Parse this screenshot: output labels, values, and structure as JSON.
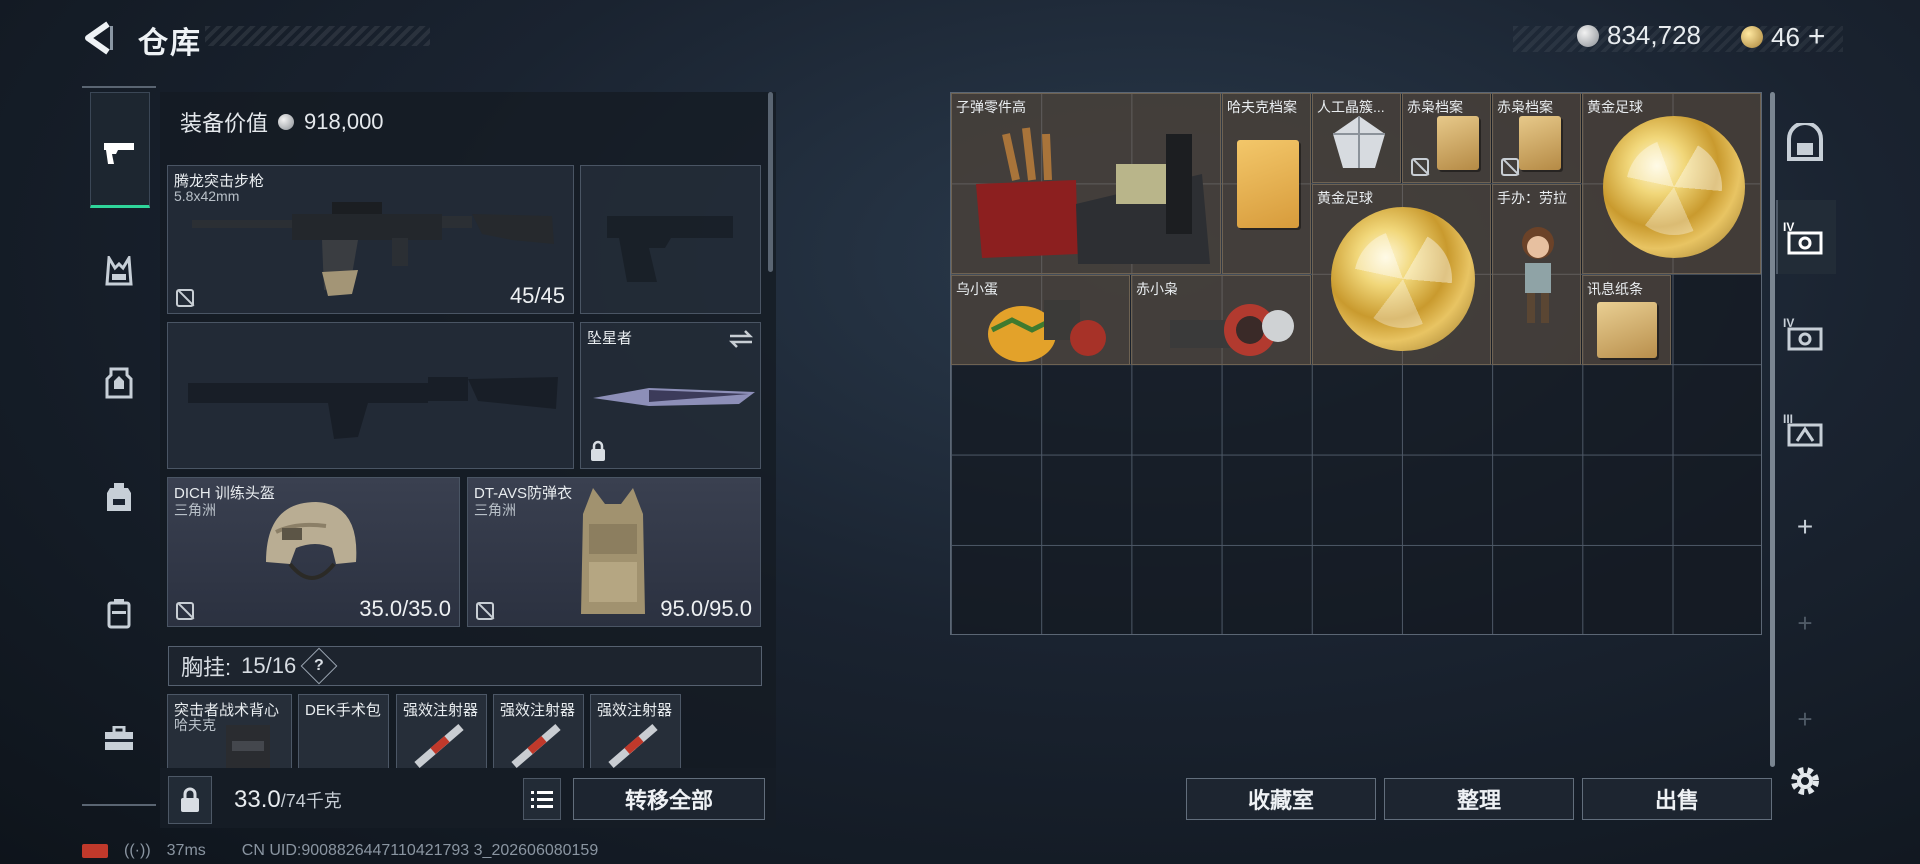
{
  "header": {
    "title": "仓库",
    "silver_amount": "834,728",
    "gold_amount": "46",
    "gold_plus": "+"
  },
  "left_panel": {
    "equipment_value_label": "装备价值",
    "equipment_value": "918,000",
    "primary_weapon": {
      "name": "腾龙突击步枪",
      "caliber": "5.8x42mm",
      "ammo": "45/45"
    },
    "melee": {
      "name": "坠星者"
    },
    "helmet": {
      "name": "DICH 训练头盔",
      "faction": "三角洲",
      "durability": "35.0/35.0"
    },
    "armor": {
      "name": "DT-AVS防弹衣",
      "faction": "三角洲",
      "durability": "95.0/95.0"
    },
    "chest_rig": {
      "label": "胸挂:",
      "capacity": "15/16",
      "help": "?"
    },
    "pouch_items": [
      {
        "name": "突击者战术背心",
        "sub": "哈夫克"
      },
      {
        "name": "DEK手术包",
        "sub": ""
      },
      {
        "name": "强效注射器",
        "sub": ""
      },
      {
        "name": "强效注射器",
        "sub": ""
      },
      {
        "name": "强效注射器",
        "sub": ""
      }
    ],
    "weight_value": "33.0",
    "weight_max": "/74千克",
    "transfer_all_label": "转移全部"
  },
  "stash": {
    "items": [
      {
        "name": "子弹零件高"
      },
      {
        "name": "哈夫克档案"
      },
      {
        "name": "人工晶簇..."
      },
      {
        "name": "赤枭档案"
      },
      {
        "name": "赤枭档案"
      },
      {
        "name": "黄金足球"
      },
      {
        "name": "黄金足球"
      },
      {
        "name": "手办：劳拉"
      },
      {
        "name": "乌小蛋"
      },
      {
        "name": "赤小枭"
      },
      {
        "name": "讯息纸条"
      }
    ],
    "buttons": {
      "collection": "收藏室",
      "organize": "整理",
      "sell": "出售"
    }
  },
  "status_bar": {
    "ping": "37ms",
    "uid": "CN UID:9008826447110421793 3_202606080159"
  },
  "colors": {
    "accent_green": "#2fd59a",
    "background": "#1a2330",
    "item_tint": "#786450"
  },
  "icons": {
    "back": "back-arrow-icon",
    "silver": "silver-coin-icon",
    "gold": "gold-coin-icon",
    "rail": [
      "pistol-icon",
      "chest-rig-icon",
      "armor-vest-icon",
      "backpack-icon",
      "case-icon",
      "toolbox-icon"
    ],
    "right_rail": [
      "safe-box-icon",
      "stash-tab-4-icon",
      "stash-tab-4b-icon",
      "stash-tab-3-icon",
      "add-icon",
      "add-disabled-icon",
      "add-disabled-icon",
      "settings-icon"
    ]
  }
}
